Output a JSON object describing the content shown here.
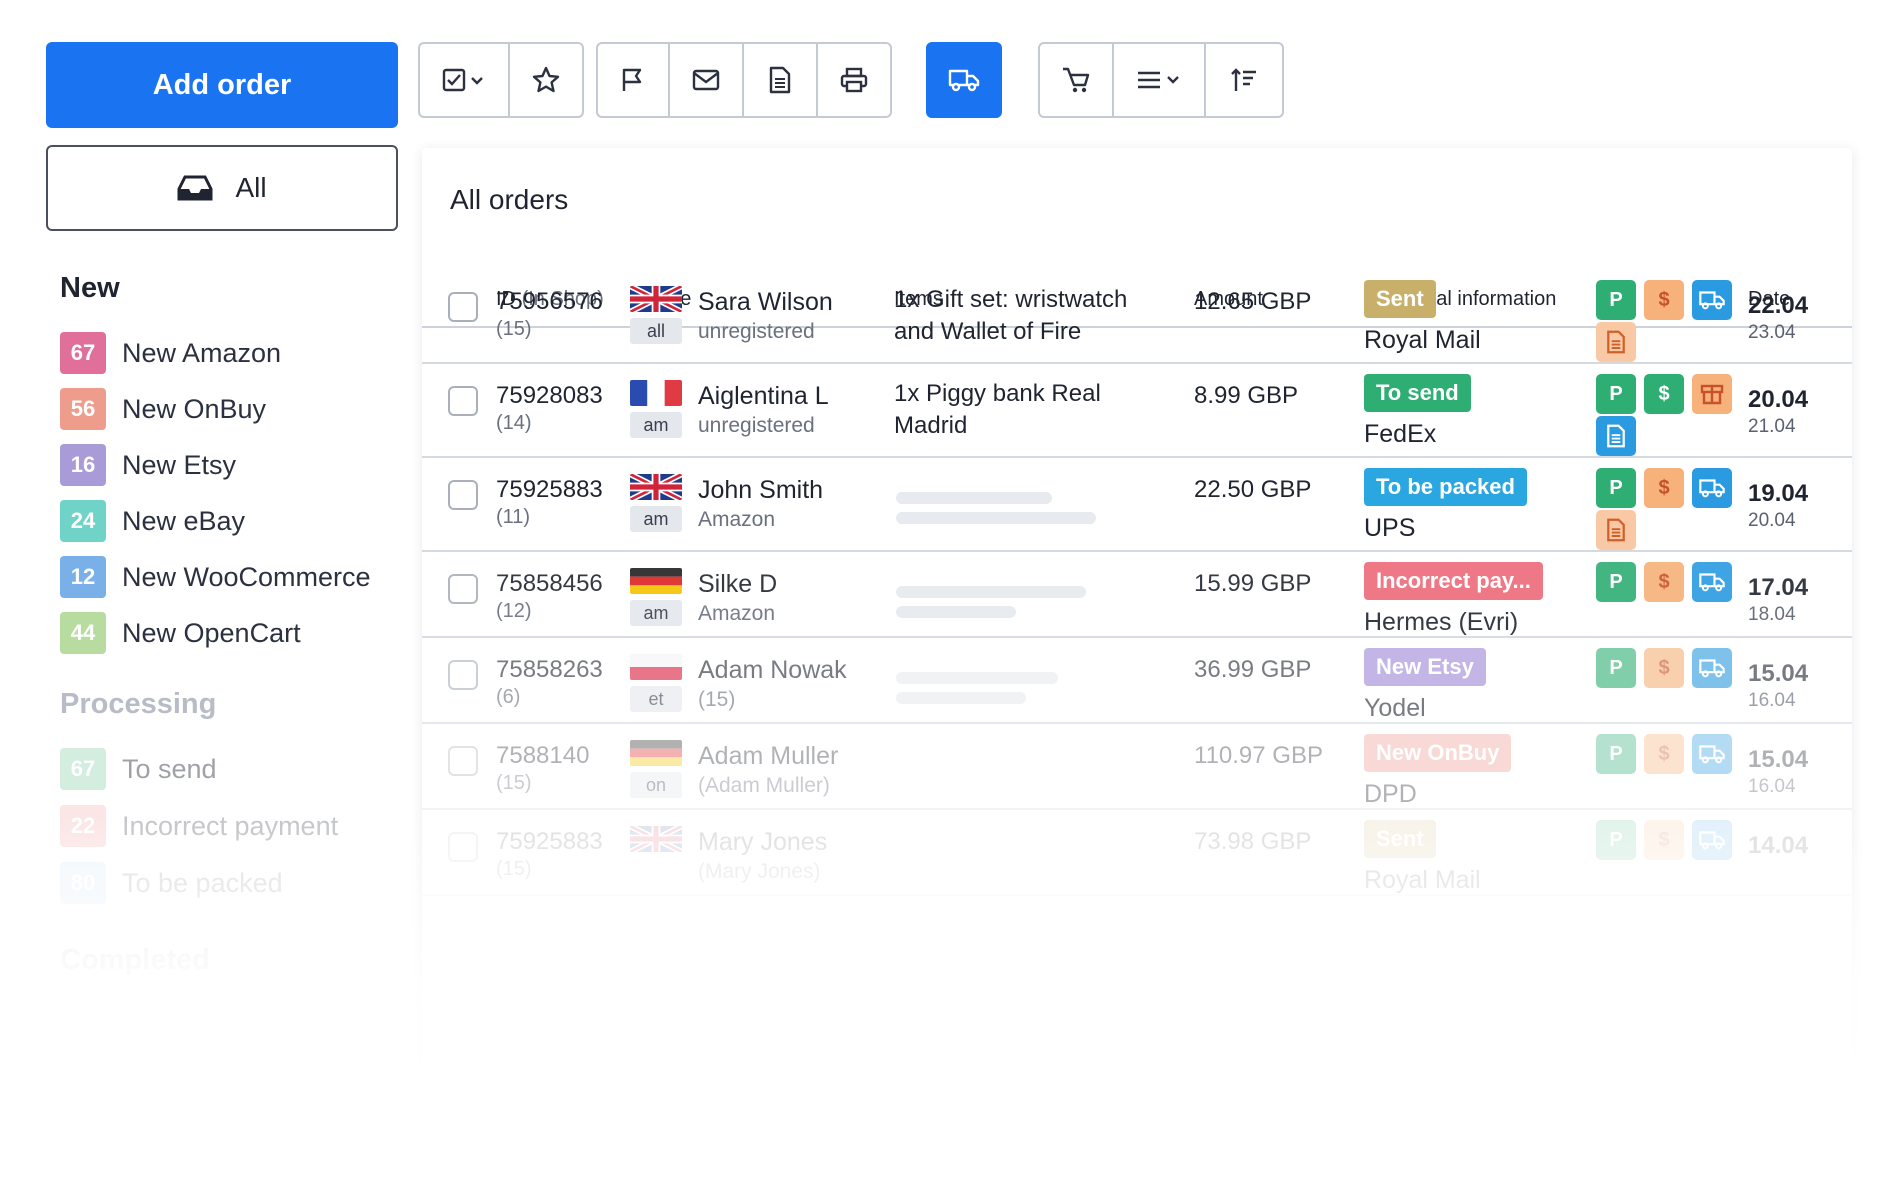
{
  "sidebar": {
    "add_order_label": "Add order",
    "all_label": "All",
    "new_heading": "New",
    "new_items": [
      {
        "count": "67",
        "label": "New Amazon",
        "color": "#e0709a"
      },
      {
        "count": "56",
        "label": "New OnBuy",
        "color": "#ee9c8c"
      },
      {
        "count": "16",
        "label": "New Etsy",
        "color": "#a99ad8"
      },
      {
        "count": "24",
        "label": "New eBay",
        "color": "#6fd3c8"
      },
      {
        "count": "12",
        "label": "New WooCommerce",
        "color": "#7ab0e8"
      },
      {
        "count": "44",
        "label": "New OpenCart",
        "color": "#b8dca0"
      }
    ],
    "processing_heading": "Processing",
    "processing_items": [
      {
        "count": "67",
        "label": "To send",
        "color": "#9ed8b8"
      },
      {
        "count": "22",
        "label": "Incorrect payment",
        "color": "#f2a8a8"
      },
      {
        "count": "80",
        "label": "To be packed",
        "color": "#a8d4ee"
      }
    ],
    "completed_heading": "Completed"
  },
  "toolbar": {
    "active_color": "#1a73f0",
    "icons": [
      "checkbox-dropdown-icon",
      "star-icon",
      "flag-icon",
      "mail-icon",
      "document-icon",
      "printer-icon",
      "truck-icon",
      "cart-icon",
      "menu-dropdown-icon",
      "sort-icon"
    ]
  },
  "orders": {
    "title": "All orders",
    "headers": {
      "id": "ID",
      "id_sub": "(In Shop)",
      "name": "Name",
      "items": "Items",
      "amount": "Amount",
      "info": "Additional information",
      "date": "Date"
    },
    "rows": [
      {
        "id": "75956576",
        "shop_id": "(15)",
        "flag": "uk",
        "tag": "all",
        "name": "Sara Wilson",
        "account": "unregistered",
        "items": "1x Gift set: wristwatch and Wallet of Fire",
        "amount": "12.65 GBP",
        "status": "Sent",
        "status_color": "#c9b06a",
        "courier": "Royal Mail",
        "icons": [
          "paypal-icon",
          "dollar-icon",
          "truck-icon",
          "invoice-icon"
        ],
        "date": "22.04",
        "date2": "23.04"
      },
      {
        "id": "75928083",
        "shop_id": "(14)",
        "flag": "fr",
        "tag": "am",
        "name": "Aiglentina L",
        "account": "unregistered",
        "items": "1x Piggy bank Real Madrid",
        "amount": "8.99 GBP",
        "status": "To send",
        "status_color": "#2fae74",
        "courier": "FedEx",
        "icons": [
          "paypal-icon",
          "dollar-icon",
          "package-icon",
          "invoice-icon"
        ],
        "date": "20.04",
        "date2": "21.04"
      },
      {
        "id": "75925883",
        "shop_id": "(11)",
        "flag": "uk",
        "tag": "am",
        "name": "John Smith",
        "account": "Amazon",
        "items": "",
        "amount": "22.50 GBP",
        "status": "To be packed",
        "status_color": "#2aa7e0",
        "courier": "UPS",
        "icons": [
          "paypal-icon",
          "dollar-icon",
          "truck-icon",
          "invoice-icon"
        ],
        "date": "19.04",
        "date2": "20.04"
      },
      {
        "id": "75858456",
        "shop_id": "(12)",
        "flag": "de",
        "tag": "am",
        "name": "Silke D",
        "account": "Amazon",
        "items": "",
        "amount": "15.99 GBP",
        "status": "Incorrect pay...",
        "status_color": "#ee6a7a",
        "courier": "Hermes (Evri)",
        "icons": [
          "paypal-icon",
          "dollar-icon",
          "truck-icon"
        ],
        "date": "17.04",
        "date2": "18.04"
      },
      {
        "id": "75858263",
        "shop_id": "(6)",
        "flag": "pl",
        "tag": "et",
        "name": "Adam Nowak",
        "account": "(15)",
        "items": "",
        "amount": "36.99 GBP",
        "status": "New Etsy",
        "status_color": "#9c86d8",
        "courier": "Yodel",
        "icons": [
          "paypal-icon",
          "dollar-icon",
          "truck-icon"
        ],
        "date": "15.04",
        "date2": "16.04"
      },
      {
        "id": "7588140",
        "shop_id": "(15)",
        "flag": "de",
        "tag": "on",
        "name": "Adam Muller",
        "account": "(Adam Muller)",
        "items": "",
        "amount": "110.97 GBP",
        "status": "New OnBuy",
        "status_color": "#f0948a",
        "courier": "DPD",
        "icons": [
          "paypal-icon",
          "dollar-icon",
          "truck-icon"
        ],
        "date": "15.04",
        "date2": "16.04"
      },
      {
        "id": "75925883",
        "shop_id": "(15)",
        "flag": "uk",
        "tag": "",
        "name": "Mary Jones",
        "account": "(Mary Jones)",
        "items": "",
        "amount": "73.98 GBP",
        "status": "Sent",
        "status_color": "#c9b06a",
        "courier": "Royal Mail",
        "icons": [
          "paypal-icon",
          "dollar-icon",
          "truck-icon"
        ],
        "date": "14.04",
        "date2": ""
      }
    ]
  }
}
